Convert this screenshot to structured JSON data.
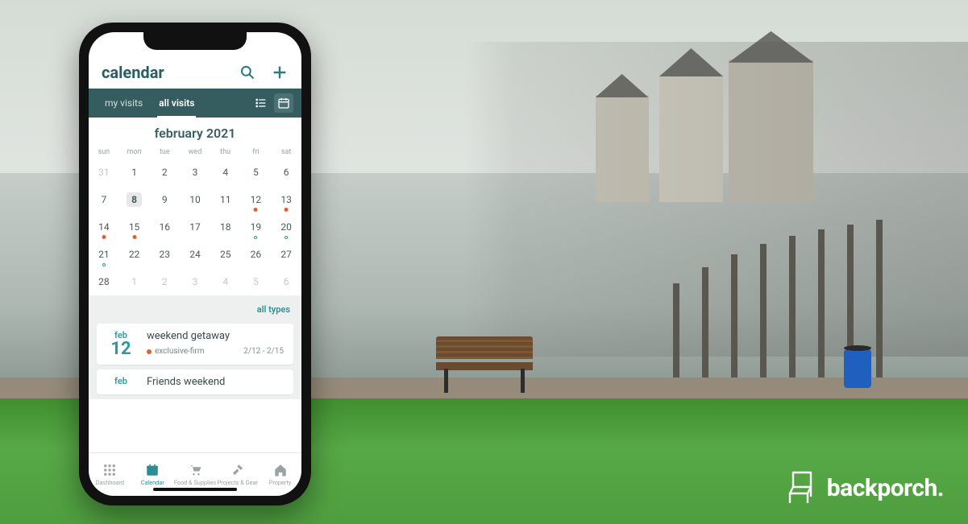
{
  "brand": "backporch.",
  "app": {
    "title": "calendar",
    "tabs": {
      "my": "my visits",
      "all": "all visits",
      "active": "all"
    },
    "month_label": "february 2021",
    "dow": [
      "sun",
      "mon",
      "tue",
      "wed",
      "thu",
      "fri",
      "sat"
    ],
    "weeks": [
      [
        {
          "n": "31",
          "o": true
        },
        {
          "n": "1"
        },
        {
          "n": "2"
        },
        {
          "n": "3"
        },
        {
          "n": "4"
        },
        {
          "n": "5"
        },
        {
          "n": "6"
        }
      ],
      [
        {
          "n": "7"
        },
        {
          "n": "8",
          "sel": true
        },
        {
          "n": "9"
        },
        {
          "n": "10"
        },
        {
          "n": "11"
        },
        {
          "n": "12",
          "d": "o"
        },
        {
          "n": "13",
          "d": "o"
        }
      ],
      [
        {
          "n": "14",
          "d": "o"
        },
        {
          "n": "15",
          "d": "o"
        },
        {
          "n": "16"
        },
        {
          "n": "17"
        },
        {
          "n": "18"
        },
        {
          "n": "19",
          "d": "t"
        },
        {
          "n": "20",
          "d": "t"
        }
      ],
      [
        {
          "n": "21",
          "d": "t"
        },
        {
          "n": "22"
        },
        {
          "n": "23"
        },
        {
          "n": "24"
        },
        {
          "n": "25"
        },
        {
          "n": "26"
        },
        {
          "n": "27"
        }
      ],
      [
        {
          "n": "28"
        },
        {
          "n": "1",
          "o": true
        },
        {
          "n": "2",
          "o": true
        },
        {
          "n": "3",
          "o": true
        },
        {
          "n": "4",
          "o": true
        },
        {
          "n": "5",
          "o": true
        },
        {
          "n": "6",
          "o": true
        }
      ]
    ],
    "filter": "all types",
    "events": [
      {
        "month": "feb",
        "day": "12",
        "title": "weekend getaway",
        "tag": "exclusive-firm",
        "range": "2/12 - 2/15"
      },
      {
        "month": "feb",
        "day": "",
        "title": "Friends weekend",
        "tag": "",
        "range": ""
      }
    ],
    "nav": [
      {
        "label": "Dashboard",
        "active": false,
        "icon": "grid"
      },
      {
        "label": "Calendar",
        "active": true,
        "icon": "calendar"
      },
      {
        "label": "Food & Supplies",
        "active": false,
        "icon": "cart"
      },
      {
        "label": "Projects & Gear",
        "active": false,
        "icon": "hammer"
      },
      {
        "label": "Property",
        "active": false,
        "icon": "home"
      }
    ]
  }
}
